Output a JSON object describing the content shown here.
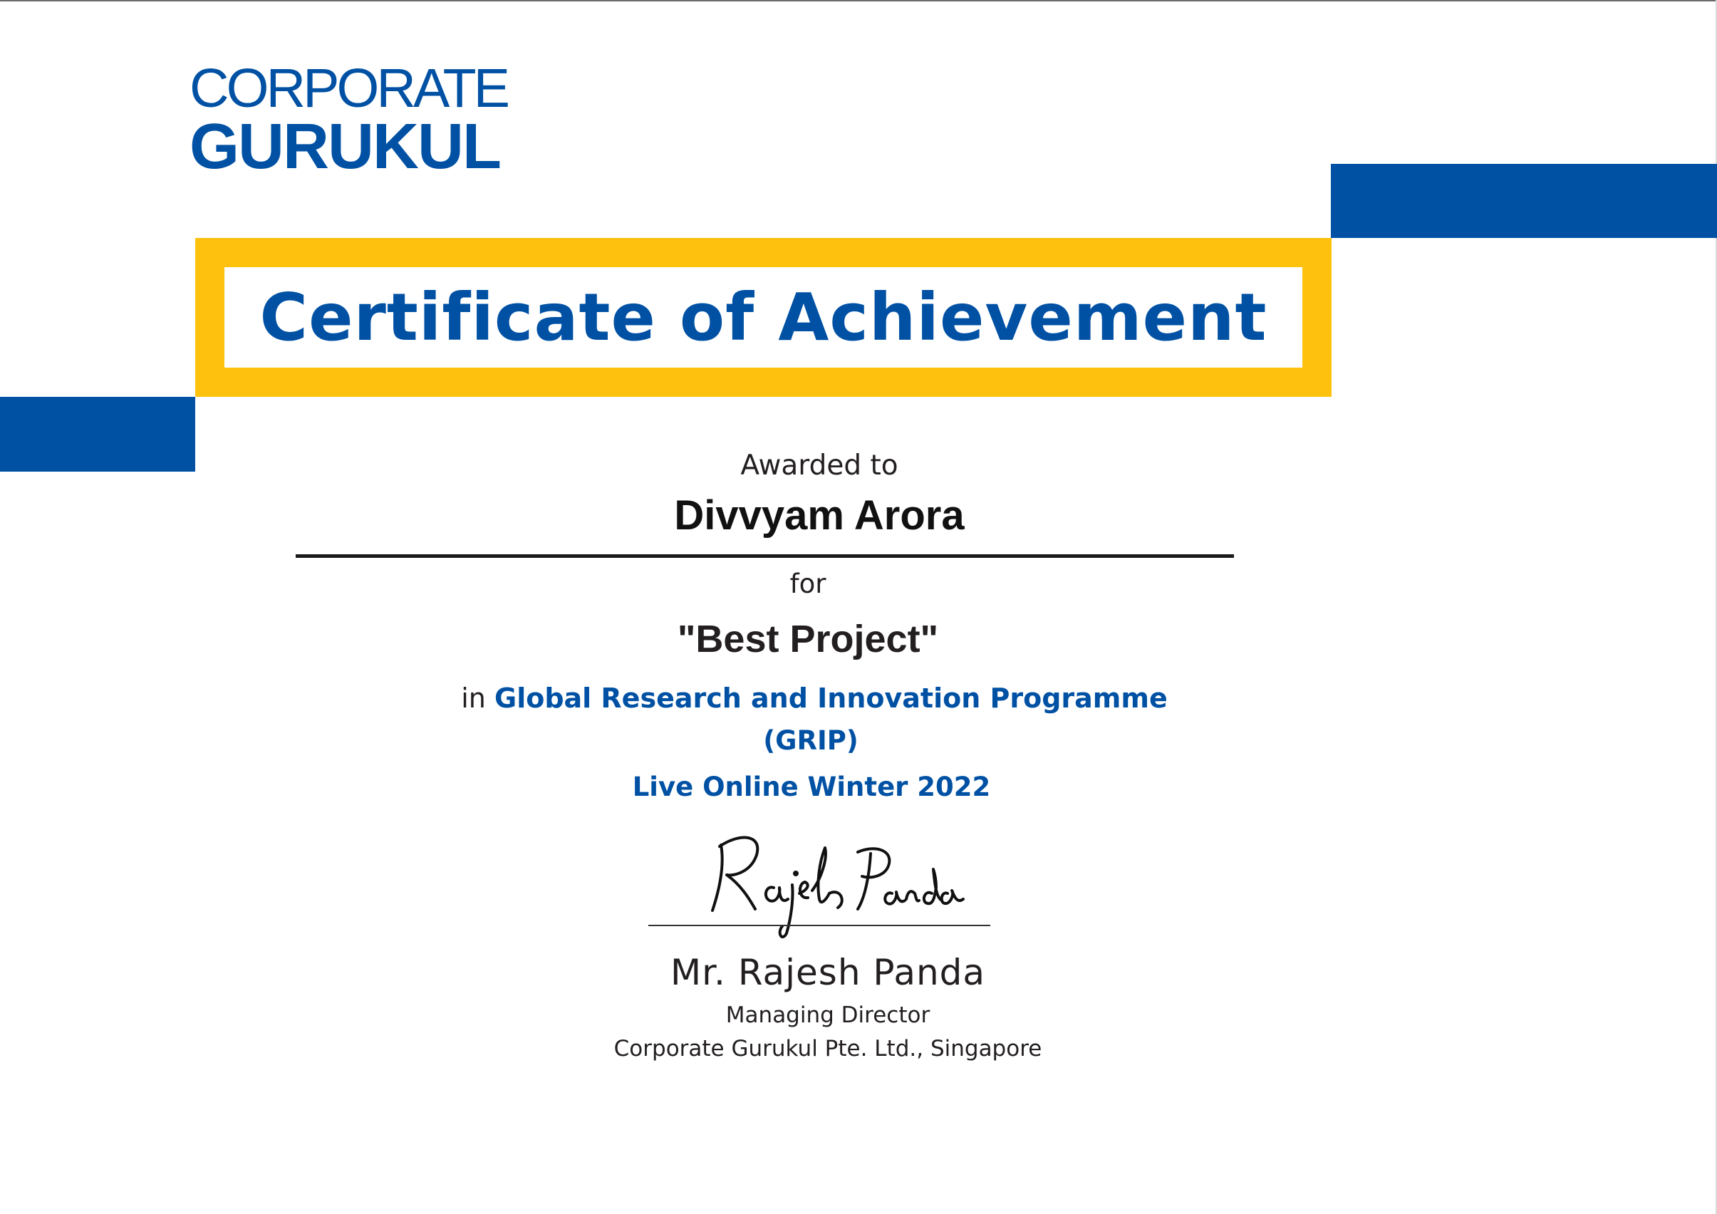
{
  "logo": {
    "line1": "CORPORATE",
    "line2": "GURUKUL"
  },
  "certificate": {
    "title": "Certificate of Achievement",
    "awarded_label": "Awarded to",
    "recipient": "Divvyam Arora",
    "for_label": "for",
    "award": "\"Best Project\"",
    "programme_prefix": "in",
    "programme_name": "Global Research and Innovation Programme",
    "programme_abbr": "(GRIP)",
    "session": "Live Online Winter 2022"
  },
  "signatory": {
    "signature_text": "Rajesh Panda",
    "name": "Mr. Rajesh Panda",
    "title": "Managing Director",
    "organization": "Corporate Gurukul Pte. Ltd., Singapore"
  },
  "colors": {
    "brand_blue": "#0051a4",
    "frame_yellow": "#fec10e",
    "text_dark": "#231f20"
  }
}
